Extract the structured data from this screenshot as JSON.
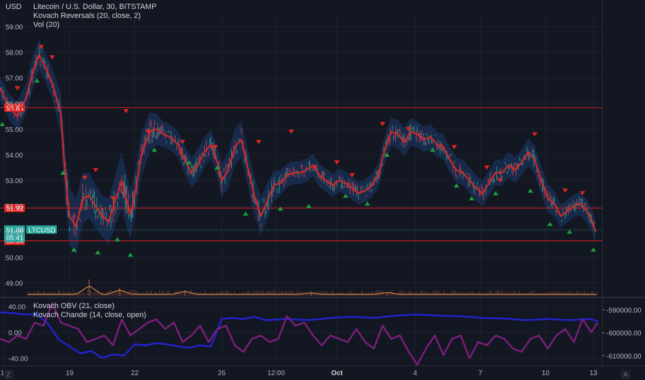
{
  "header": {
    "currency": "USD",
    "title": "Litecoin / U.S. Dollar, 30, BITSTAMP",
    "indicator1": "Kovach Reversals (20, close, 2)",
    "indicator2": "Vol (20)"
  },
  "lower_pane": {
    "indicator1": "Kovach OBV (21, close)",
    "indicator2": "Kovach Chande (14, close, open)"
  },
  "buttons": {
    "zoom": "Z",
    "auto": "A"
  },
  "colors": {
    "background": "#131722",
    "grid": "#1e2230",
    "price_line": "#d22a2a",
    "band": "#1d3a6b",
    "level": "#e01e1e",
    "symbol_label": "#26a69a",
    "volume": "#d08a4a",
    "obv": "#2222d0",
    "chande": "#7a1f7a",
    "up_arrow": "#1a9e3a",
    "down_arrow": "#e02424"
  },
  "chart_data": [
    {
      "type": "line",
      "title": "Litecoin / U.S. Dollar, 30, BITSTAMP",
      "ylabel": "USD",
      "ylim": [
        48.5,
        59.5
      ],
      "yticks": [
        49.0,
        50.0,
        51.0,
        52.0,
        53.0,
        54.0,
        55.0,
        56.0,
        57.0,
        58.0,
        59.0
      ],
      "ytick_labels": [
        "49.00",
        "50.00",
        "51.00",
        "52.00",
        "53.00",
        "54.00",
        "55.00",
        "56.00",
        "57.00",
        "58.00",
        "59.00"
      ],
      "xlim": [
        15.8,
        43.5
      ],
      "xticks": [
        16,
        19,
        22,
        26,
        28.5,
        31.3,
        34.9,
        37.9,
        40.9,
        43.1
      ],
      "xtick_labels": [
        "16",
        "19",
        "22",
        "26",
        "12:00",
        "Oct",
        "4",
        "7",
        "10",
        "13"
      ],
      "grid": true,
      "series": [
        {
          "x": [
            15.8,
            16.2,
            16.6,
            17.0,
            17.3,
            17.6,
            17.9,
            18.2,
            18.6,
            18.8,
            19.0,
            19.3,
            19.6,
            19.9,
            20.2,
            20.5,
            20.8,
            21.1,
            21.4,
            21.6,
            21.8,
            22.0,
            22.3,
            22.7,
            23.0,
            23.3,
            23.6,
            24.0,
            24.3,
            24.6,
            24.9,
            25.2,
            25.5,
            25.8,
            26.0,
            26.3,
            26.6,
            26.9,
            27.2,
            27.5,
            27.8,
            28.1,
            28.4,
            28.7,
            29.0,
            29.3,
            29.6,
            29.9,
            30.2,
            30.5,
            30.8,
            31.1,
            31.4,
            31.7,
            32.0,
            32.3,
            32.6,
            32.9,
            33.2,
            33.5,
            33.8,
            34.1,
            34.4,
            34.7,
            35.0,
            35.3,
            35.6,
            35.9,
            36.2,
            36.5,
            36.8,
            37.1,
            37.4,
            37.7,
            38.0,
            38.3,
            38.6,
            38.9,
            39.2,
            39.5,
            39.8,
            40.1,
            40.4,
            40.7,
            41.0,
            41.3,
            41.6,
            41.9,
            42.2,
            42.5,
            42.8,
            43.0,
            43.2
          ],
          "values": [
            56.6,
            55.9,
            55.5,
            56.2,
            57.2,
            57.9,
            57.4,
            56.8,
            55.6,
            53.2,
            51.6,
            51.2,
            52.3,
            52.4,
            52.0,
            51.6,
            51.4,
            52.2,
            53.0,
            52.3,
            51.7,
            52.4,
            54.0,
            54.9,
            55.0,
            54.8,
            54.7,
            54.4,
            53.8,
            53.3,
            53.6,
            54.1,
            54.4,
            53.7,
            53.0,
            53.4,
            54.3,
            54.6,
            53.5,
            52.4,
            51.6,
            52.2,
            52.8,
            52.9,
            53.2,
            53.3,
            53.3,
            53.4,
            53.6,
            53.2,
            53.0,
            52.8,
            53.0,
            52.9,
            52.7,
            52.5,
            52.6,
            52.8,
            53.2,
            54.2,
            54.9,
            54.8,
            54.5,
            54.9,
            54.8,
            54.6,
            54.7,
            54.4,
            54.3,
            53.8,
            53.4,
            53.3,
            53.0,
            52.7,
            52.5,
            52.9,
            53.3,
            53.3,
            53.6,
            53.4,
            53.7,
            54.1,
            53.8,
            53.0,
            52.3,
            52.1,
            51.6,
            51.8,
            52.0,
            52.1,
            51.8,
            51.5,
            51.0
          ],
          "band": [
            0.45,
            0.5,
            0.55,
            0.6,
            0.65,
            0.6,
            0.55,
            0.6,
            0.8,
            1.0,
            1.1,
            1.1,
            1.0,
            0.9,
            0.85,
            0.8,
            0.9,
            1.0,
            1.1,
            1.05,
            0.95,
            0.9,
            0.85,
            0.75,
            0.6,
            0.5,
            0.5,
            0.5,
            0.55,
            0.6,
            0.6,
            0.6,
            0.55,
            0.6,
            0.65,
            0.7,
            0.7,
            0.7,
            0.7,
            0.75,
            0.75,
            0.7,
            0.6,
            0.5,
            0.45,
            0.45,
            0.45,
            0.45,
            0.45,
            0.45,
            0.45,
            0.45,
            0.45,
            0.45,
            0.45,
            0.45,
            0.45,
            0.45,
            0.5,
            0.55,
            0.55,
            0.55,
            0.55,
            0.55,
            0.5,
            0.5,
            0.5,
            0.5,
            0.5,
            0.5,
            0.5,
            0.5,
            0.5,
            0.5,
            0.5,
            0.5,
            0.5,
            0.5,
            0.5,
            0.5,
            0.5,
            0.55,
            0.55,
            0.55,
            0.55,
            0.5,
            0.45,
            0.45,
            0.45,
            0.45,
            0.45,
            0.45,
            0.45
          ]
        }
      ],
      "levels": [
        {
          "value": 55.84,
          "label": "55.84"
        },
        {
          "value": 51.92,
          "label": "51.92"
        },
        {
          "value": 50.64,
          "label": "50.64"
        }
      ],
      "last_price": {
        "value": 51.08,
        "label": "51.08",
        "symbol": "LTCUSD",
        "countdown": "05:41"
      },
      "down_markers": [
        [
          16.6,
          56.6
        ],
        [
          17.7,
          58.2
        ],
        [
          18.2,
          57.8
        ],
        [
          19.7,
          53.1
        ],
        [
          20.2,
          53.4
        ],
        [
          21.0,
          52.3
        ],
        [
          21.6,
          55.7
        ],
        [
          22.6,
          54.9
        ],
        [
          24.2,
          54.5
        ],
        [
          25.7,
          54.3
        ],
        [
          27.7,
          54.5
        ],
        [
          29.2,
          54.9
        ],
        [
          30.3,
          53.5
        ],
        [
          31.3,
          53.7
        ],
        [
          32.0,
          53.2
        ],
        [
          33.4,
          55.2
        ],
        [
          34.6,
          55.0
        ],
        [
          36.7,
          54.3
        ],
        [
          38.2,
          53.5
        ],
        [
          38.8,
          53.0
        ],
        [
          40.4,
          54.8
        ],
        [
          41.8,
          52.6
        ],
        [
          42.6,
          52.5
        ]
      ],
      "up_markers": [
        [
          15.9,
          55.2
        ],
        [
          17.5,
          56.9
        ],
        [
          18.7,
          53.3
        ],
        [
          19.2,
          50.3
        ],
        [
          20.3,
          50.2
        ],
        [
          21.2,
          50.7
        ],
        [
          21.8,
          50.1
        ],
        [
          22.9,
          54.2
        ],
        [
          24.5,
          53.7
        ],
        [
          25.8,
          53.5
        ],
        [
          27.1,
          51.7
        ],
        [
          28.7,
          51.9
        ],
        [
          30.0,
          52.0
        ],
        [
          31.7,
          52.4
        ],
        [
          32.7,
          52.1
        ],
        [
          33.6,
          54.0
        ],
        [
          35.7,
          54.2
        ],
        [
          36.8,
          52.8
        ],
        [
          37.5,
          52.3
        ],
        [
          38.6,
          52.5
        ],
        [
          40.2,
          52.6
        ],
        [
          41.1,
          51.3
        ],
        [
          42.0,
          51.0
        ],
        [
          43.1,
          50.3
        ]
      ],
      "volume_spikes": [
        [
          19.9,
          0.9
        ],
        [
          21.3,
          0.45
        ],
        [
          24.3,
          0.3
        ],
        [
          30.1,
          0.15
        ],
        [
          33.6,
          0.2
        ]
      ]
    },
    {
      "type": "line",
      "title": "Kovach OBV (21, close)",
      "ylim": [
        -50,
        52
      ],
      "yticks": [
        40,
        0,
        -40
      ],
      "ytick_labels": [
        "40.00",
        "0.00",
        "-40.00"
      ],
      "right_yticks": [
        -590000,
        -600000,
        -610000
      ],
      "right_ytick_labels": [
        "-590000.00",
        "-600000.00",
        "-610000.00"
      ],
      "right_ylim": [
        -614000,
        -585000
      ],
      "series": [
        {
          "name": "Kovach OBV (21, close)",
          "x": [
            15.8,
            16.5,
            17.0,
            17.5,
            18.0,
            18.5,
            19.0,
            19.5,
            20.0,
            20.5,
            21.0,
            21.5,
            22.0,
            22.5,
            23.0,
            23.5,
            24.0,
            24.5,
            25.0,
            25.5,
            26.0,
            26.5,
            27.0,
            27.5,
            28.0,
            29.0,
            30.0,
            31.0,
            32.0,
            33.0,
            34.0,
            35.0,
            36.0,
            37.0,
            38.0,
            39.0,
            40.0,
            41.0,
            42.0,
            43.0,
            43.3
          ],
          "values": [
            -591000,
            -591500,
            -592000,
            -591800,
            -596000,
            -603000,
            -606000,
            -609000,
            -608000,
            -611000,
            -609500,
            -610000,
            -605000,
            -605500,
            -604500,
            -605000,
            -606000,
            -606500,
            -605500,
            -606000,
            -594000,
            -593500,
            -594000,
            -593000,
            -594500,
            -594000,
            -594500,
            -593500,
            -593000,
            -593500,
            -592500,
            -592000,
            -592500,
            -592800,
            -593500,
            -593800,
            -594500,
            -594000,
            -594500,
            -594000,
            -595000
          ]
        },
        {
          "name": "Kovach Chande (14, close, open)",
          "x": [
            15.8,
            16.2,
            16.6,
            17.0,
            17.4,
            17.8,
            18.2,
            18.6,
            19.0,
            19.4,
            19.8,
            20.2,
            20.6,
            21.0,
            21.4,
            21.8,
            22.2,
            22.6,
            23.0,
            23.4,
            23.8,
            24.2,
            24.6,
            25.0,
            25.4,
            25.8,
            26.2,
            26.6,
            27.0,
            27.4,
            27.8,
            28.2,
            28.6,
            29.0,
            29.4,
            29.8,
            30.2,
            30.6,
            31.0,
            31.4,
            31.8,
            32.2,
            32.6,
            33.0,
            33.4,
            33.8,
            34.2,
            34.6,
            35.0,
            35.4,
            35.8,
            36.2,
            36.6,
            37.0,
            37.4,
            37.8,
            38.2,
            38.6,
            39.0,
            39.4,
            39.8,
            40.2,
            40.6,
            41.0,
            41.4,
            41.8,
            42.2,
            42.6,
            43.0,
            43.3
          ],
          "values": [
            -10,
            -15,
            -5,
            -10,
            15,
            10,
            45,
            15,
            10,
            5,
            -15,
            -10,
            -5,
            -20,
            20,
            -5,
            5,
            15,
            20,
            5,
            15,
            -15,
            -5,
            10,
            -15,
            5,
            10,
            -20,
            -30,
            -10,
            -5,
            -15,
            -10,
            25,
            10,
            15,
            -5,
            -20,
            -5,
            -10,
            -15,
            5,
            -15,
            -25,
            10,
            -10,
            -5,
            -30,
            -50,
            -25,
            -5,
            -35,
            -10,
            -5,
            -40,
            -15,
            -20,
            -5,
            -10,
            -25,
            -30,
            -10,
            -5,
            -25,
            -5,
            5,
            -15,
            20,
            0,
            15
          ]
        }
      ]
    }
  ]
}
